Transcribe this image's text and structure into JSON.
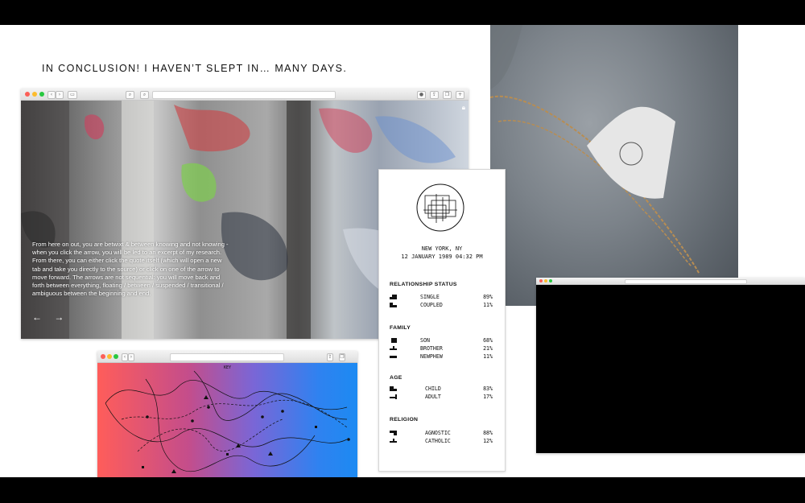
{
  "headline": "IN CONCLUSION! I HAVEN’T SLEPT IN… MANY DAYS.",
  "browser_main": {
    "intro_text": "From here on out, you are betwixt & between knowing and not knowing - when you click the arrow, you will be led to an excerpt of my research. From there, you can either click the quote itself (which will open a new tab and take you directly to the source) or click on one of the arrow to move forward. The arrows are not sequential: you will move back and forth between everything, floating / between / suspended / transitional / ambiguous between the beginning and end.",
    "arrows": "← →"
  },
  "receipt": {
    "city": "NEW YORK, NY",
    "date": "12 JANUARY 1989 04:32 PM",
    "sections": [
      {
        "title": "RELATIONSHIP STATUS",
        "rows": [
          {
            "label": "SINGLE",
            "pct": "89%"
          },
          {
            "label": "COUPLED",
            "pct": "11%"
          }
        ]
      },
      {
        "title": "FAMILY",
        "rows": [
          {
            "label": "SON",
            "pct": "68%"
          },
          {
            "label": "BROTHER",
            "pct": "21%"
          },
          {
            "label": "NEWPHEW",
            "pct": "11%"
          }
        ]
      },
      {
        "title": "AGE",
        "rows": [
          {
            "label": "CHILD",
            "pct": "83%"
          },
          {
            "label": "ADULT",
            "pct": "17%"
          }
        ]
      },
      {
        "title": "RELIGION",
        "rows": [
          {
            "label": "AGNOSTIC",
            "pct": "88%"
          },
          {
            "label": "CATHOLIC",
            "pct": "12%"
          }
        ]
      }
    ]
  },
  "browser_gradient": {
    "key_label": "KEY"
  },
  "colors": {
    "gradient_left": "#ff5d5a",
    "gradient_right": "#1c8af2",
    "accent_close": "#fc5f57"
  }
}
